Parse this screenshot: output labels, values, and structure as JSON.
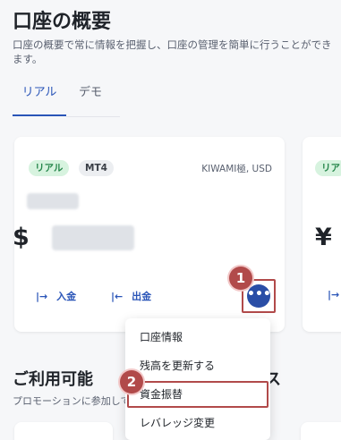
{
  "header": {
    "title": "口座の概要",
    "subtitle": "口座の概要で常に情報を把握し、口座の管理を簡単に行うことができます。"
  },
  "tabs": [
    {
      "label": "リアル",
      "active": true
    },
    {
      "label": "デモ",
      "active": false
    }
  ],
  "account_card": {
    "badge_real": "リアル",
    "badge_platform": "MT4",
    "account_type": "KIWAMI極, USD",
    "currency_symbol": "$",
    "deposit_label": "入金",
    "withdraw_label": "出金",
    "more_label": "•••"
  },
  "second_card": {
    "badge_real": "リア",
    "currency_symbol": "¥"
  },
  "menu": {
    "items": [
      {
        "label": "口座情報"
      },
      {
        "label": "残高を更新する"
      },
      {
        "label": "資金振替"
      },
      {
        "label": "レバレッジ変更"
      }
    ]
  },
  "section": {
    "title_visible": "ご利用可能",
    "title_tail": "ス",
    "subtitle_visible": "プロモーションに参加して"
  },
  "annotations": {
    "step1": "1",
    "step2": "2",
    "highlight_color": "#b14a4a"
  },
  "colors": {
    "accent": "#2a55b8",
    "real_badge_bg": "#d7f3df",
    "real_badge_text": "#25854a"
  }
}
